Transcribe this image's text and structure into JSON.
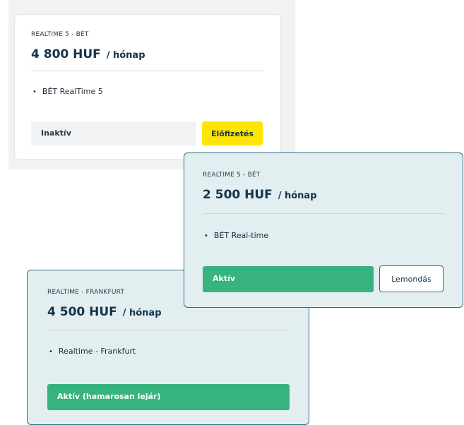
{
  "cards": [
    {
      "plan_name": "REALTIME 5 - BÉT",
      "price": "4 800 HUF",
      "period": "/ hónap",
      "features": [
        "BÉT RealTime 5"
      ],
      "status": "Inaktív",
      "action": "Előfizetés"
    },
    {
      "plan_name": "REALTIME 5 - BÉT",
      "price": "2 500 HUF",
      "period": "/ hónap",
      "features": [
        "BÉT Real-time"
      ],
      "status": "Aktív",
      "action": "Lemondás"
    },
    {
      "plan_name": "REALTIME - FRANKFURT",
      "price": "4 500 HUF",
      "period": "/ hónap",
      "features": [
        "Realtime - Frankfurt"
      ],
      "status": "Aktív (hamarosan lejár)"
    }
  ],
  "colors": {
    "accent_yellow": "#ffe500",
    "active_green": "#36b37e",
    "teal_border": "#2a6f86",
    "teal_background": "#e3eef1"
  }
}
